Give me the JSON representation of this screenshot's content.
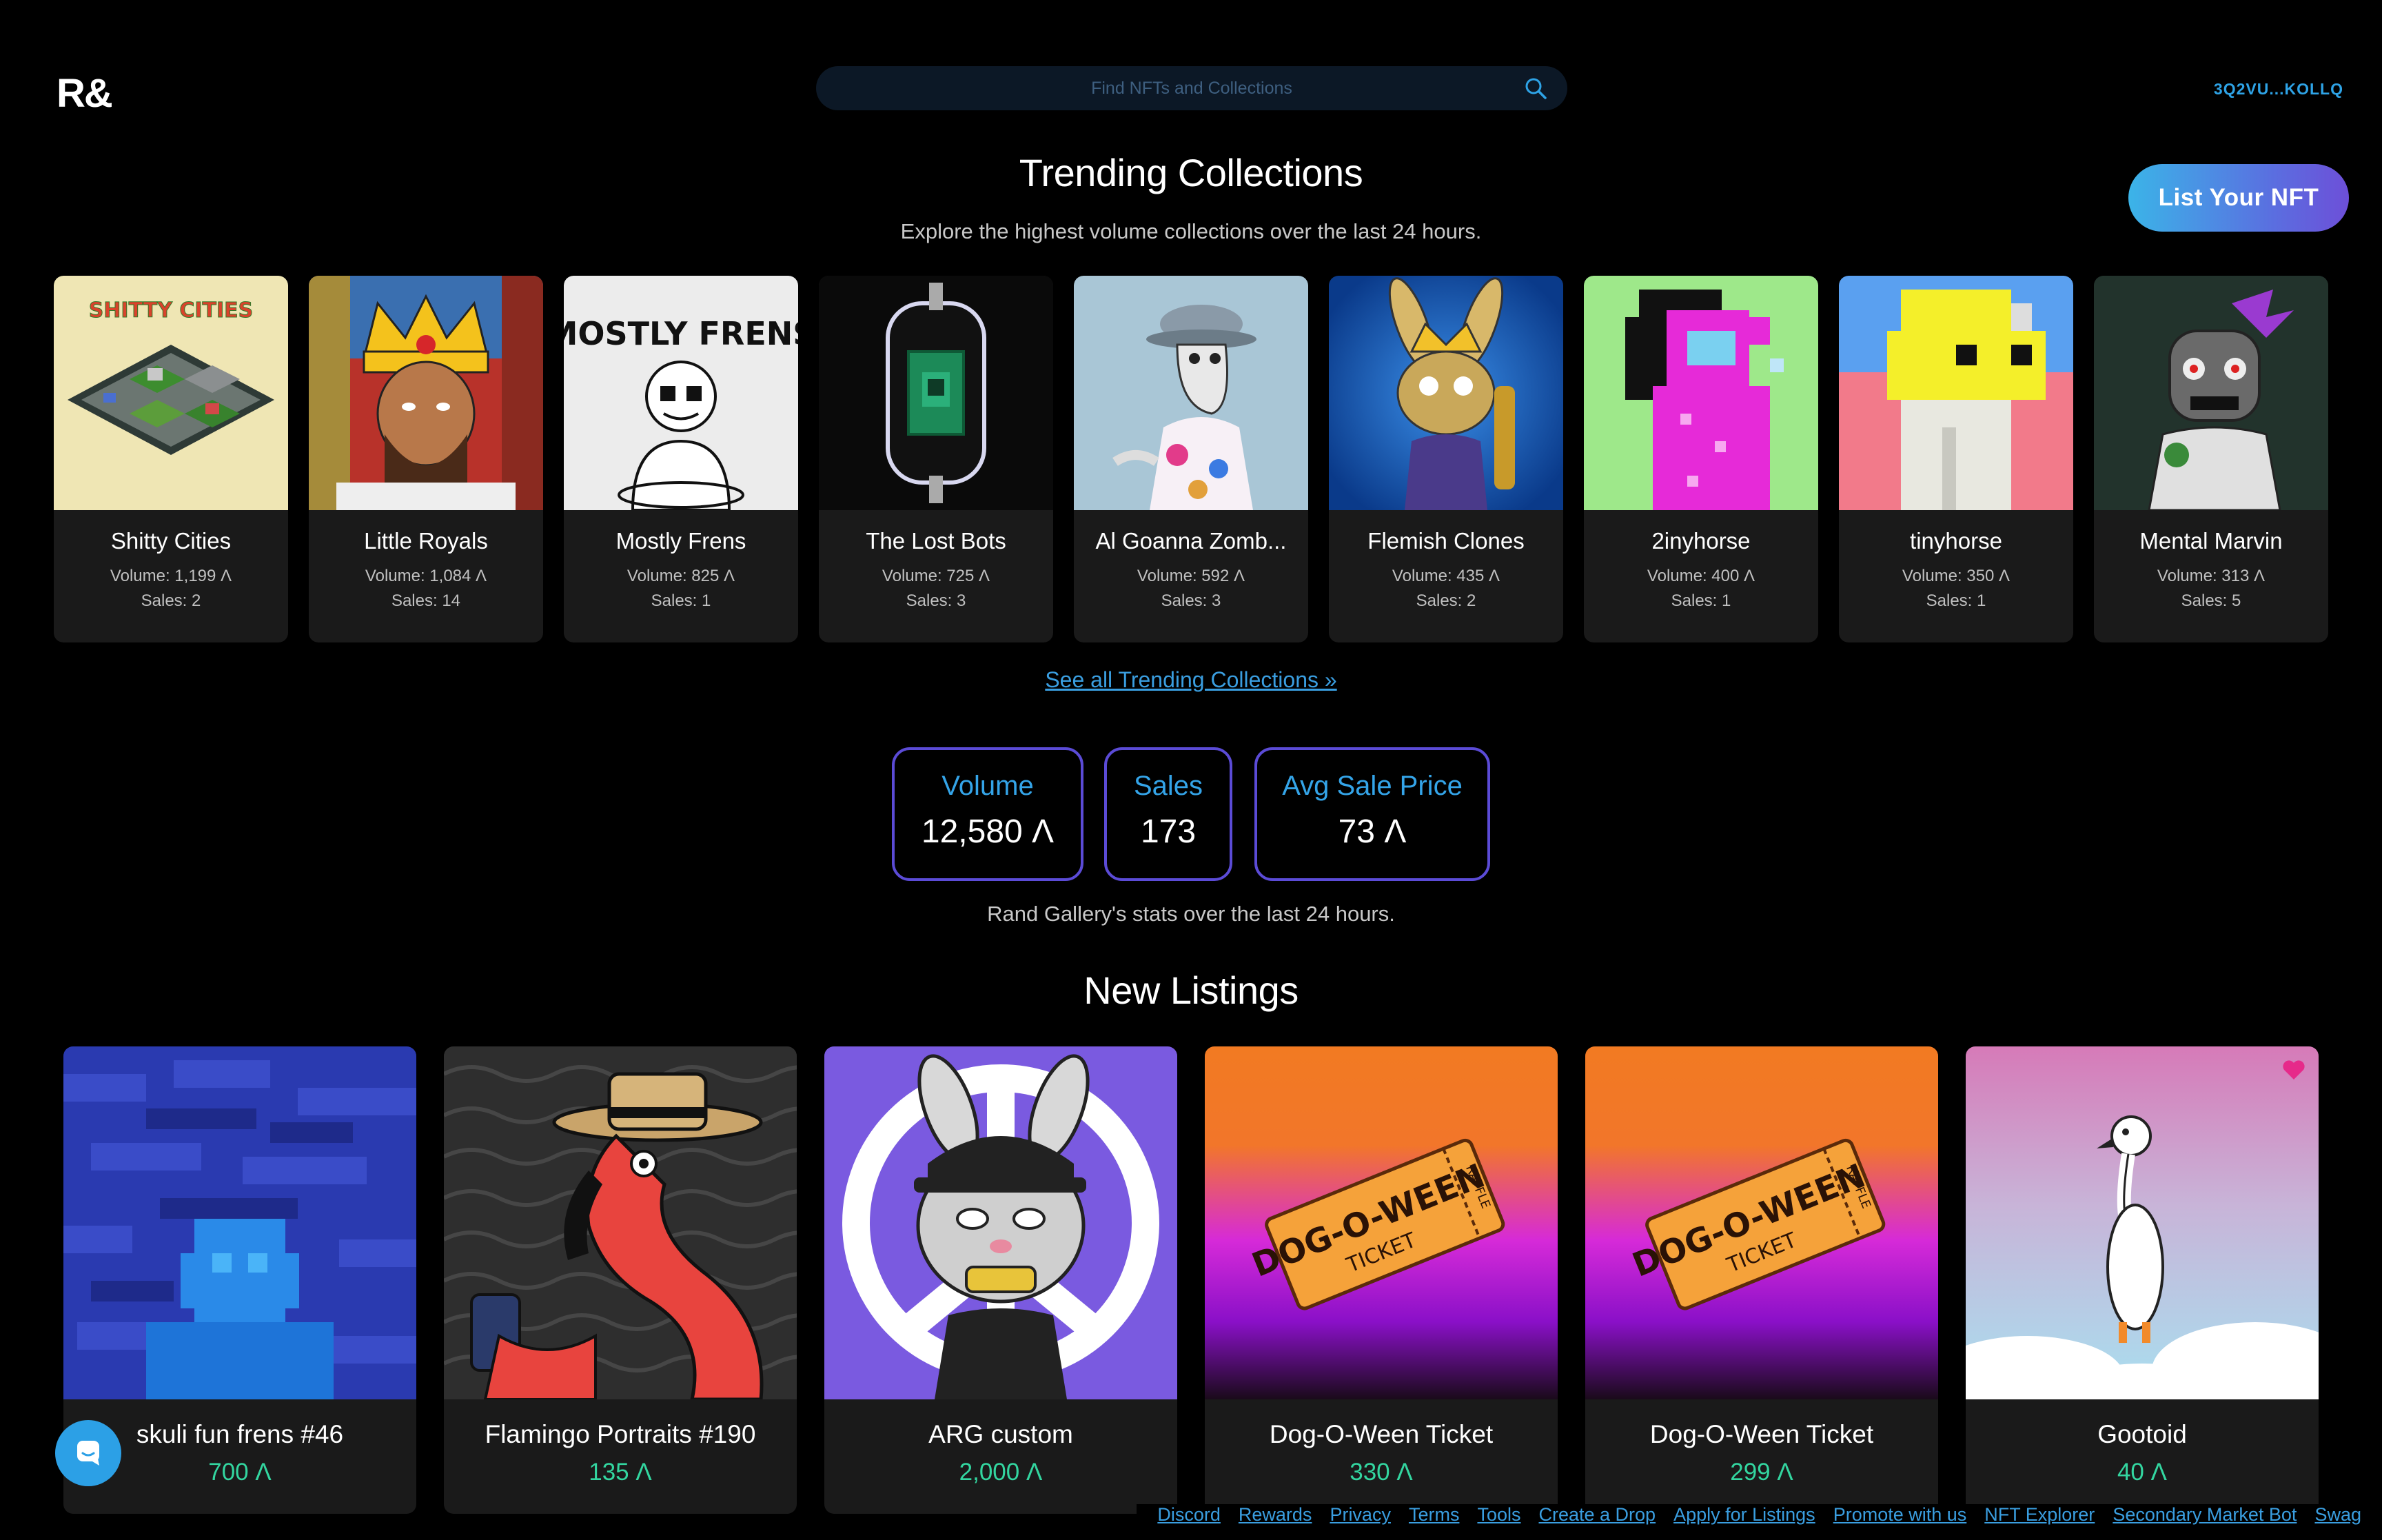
{
  "header": {
    "logo": "R&",
    "search_placeholder": "Find NFTs and Collections",
    "wallet": "3Q2VU...KOLLQ",
    "list_button": "List Your NFT"
  },
  "trending": {
    "title": "Trending Collections",
    "subtitle": "Explore the highest volume collections over the last 24 hours.",
    "see_all": "See all Trending Collections »",
    "items": [
      {
        "name": "Shitty Cities",
        "volume": "Volume: 1,199 Ʌ",
        "sales": "Sales: 2"
      },
      {
        "name": "Little Royals",
        "volume": "Volume: 1,084 Ʌ",
        "sales": "Sales: 14"
      },
      {
        "name": "Mostly Frens",
        "volume": "Volume: 825 Ʌ",
        "sales": "Sales: 1"
      },
      {
        "name": "The Lost Bots",
        "volume": "Volume: 725 Ʌ",
        "sales": "Sales: 3"
      },
      {
        "name": "Al Goanna Zomb...",
        "volume": "Volume: 592 Ʌ",
        "sales": "Sales: 3"
      },
      {
        "name": "Flemish Clones",
        "volume": "Volume: 435 Ʌ",
        "sales": "Sales: 2"
      },
      {
        "name": "2inyhorse",
        "volume": "Volume: 400 Ʌ",
        "sales": "Sales: 1"
      },
      {
        "name": "tinyhorse",
        "volume": "Volume: 350 Ʌ",
        "sales": "Sales: 1"
      },
      {
        "name": "Mental Marvin",
        "volume": "Volume: 313 Ʌ",
        "sales": "Sales: 5"
      }
    ]
  },
  "stats": {
    "volume_label": "Volume",
    "volume_value": "12,580 Ʌ",
    "sales_label": "Sales",
    "sales_value": "173",
    "avg_label": "Avg Sale Price",
    "avg_value": "73 Ʌ",
    "subtitle": "Rand Gallery's stats over the last 24 hours."
  },
  "new_listings": {
    "title": "New Listings",
    "items": [
      {
        "name": "skuli fun frens #46",
        "price": "700 Ʌ"
      },
      {
        "name": "Flamingo Portraits #190",
        "price": "135 Ʌ"
      },
      {
        "name": "ARG custom",
        "price": "2,000 Ʌ"
      },
      {
        "name": "Dog-O-Ween Ticket",
        "price": "330 Ʌ"
      },
      {
        "name": "Dog-O-Ween Ticket",
        "price": "299 Ʌ"
      },
      {
        "name": "Gootoid",
        "price": "40 Ʌ"
      }
    ]
  },
  "art_text": {
    "shitty_cities_logo": "SHITTY CITIES",
    "mostly_frens_logo": "MOSTLY FRENS",
    "ticket_main": "DOG-O-WEEN",
    "ticket_sub": "TICKET",
    "ticket_side": "RAFFLE"
  },
  "footer": {
    "links": [
      "Discord",
      "Rewards",
      "Privacy",
      "Terms",
      "Tools",
      "Create a Drop",
      "Apply for Listings",
      "Promote with us",
      "NFT Explorer",
      "Secondary Market Bot",
      "Swag"
    ]
  },
  "colors": {
    "accent_blue": "#2ea3e6",
    "stat_border": "#5b4bd6",
    "price_green": "#33d6a0",
    "card_bg": "#1a1a1a"
  },
  "icons": {
    "search": "search-icon",
    "chat": "chat-icon",
    "heart": "heart-icon"
  }
}
